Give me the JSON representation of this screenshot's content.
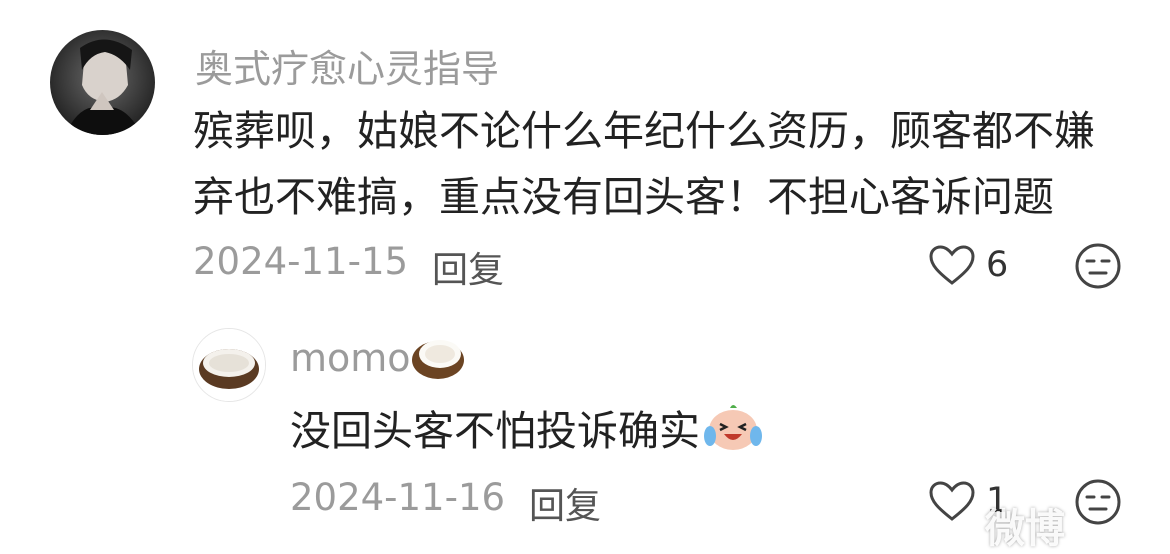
{
  "comment": {
    "username": "奥式疗愈心灵指导",
    "text_line1": "殡葬呗，姑娘不论什么年纪什么资历，顾客都不嫌",
    "text_line2": "弃也不难搞，重点没有回头客！不担心客诉问题",
    "date": "2024-11-15",
    "reply_label": "回复",
    "like_count": "6",
    "like_icon": "heart-outline-icon",
    "dislike_icon": "meh-face-icon"
  },
  "reply": {
    "username": "momo",
    "username_emoji": "coconut-icon",
    "text": "没回头客不怕投诉确实",
    "text_emoji": "laughing-crying-face-icon",
    "date": "2024-11-16",
    "reply_label": "回复",
    "like_count": "1",
    "like_icon": "heart-outline-icon",
    "dislike_icon": "meh-face-icon"
  },
  "watermark": "微博",
  "colors": {
    "background": "#ffffff",
    "username": "#9b9b9b",
    "text": "#222222",
    "meta": "#9b9b9b"
  }
}
